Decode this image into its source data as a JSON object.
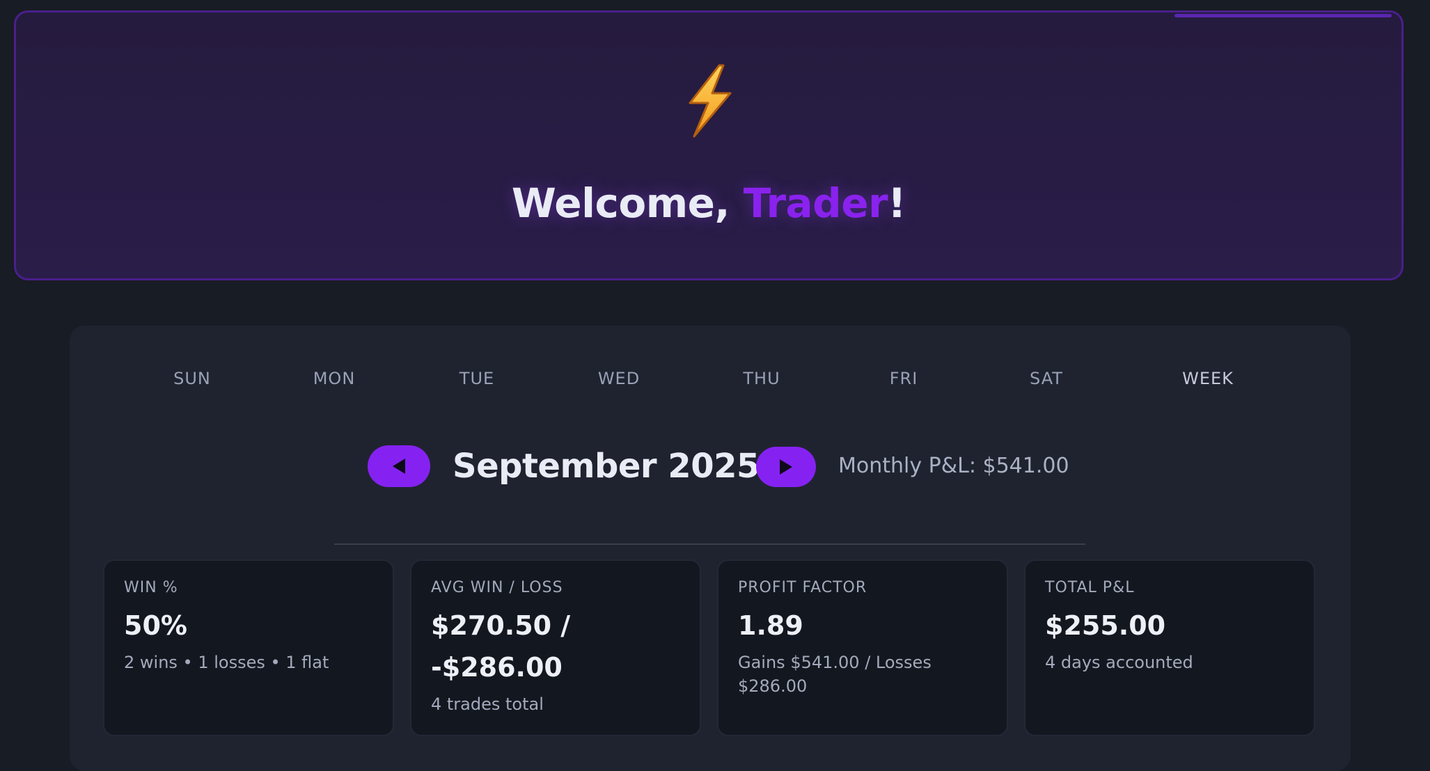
{
  "hero": {
    "icon": "lightning-bolt-icon",
    "greeting": "Welcome, ",
    "name": "Trader",
    "suffix": "!"
  },
  "calendar": {
    "weekdays": [
      "SUN",
      "MON",
      "TUE",
      "WED",
      "THU",
      "FRI",
      "SAT",
      "WEEK"
    ],
    "month_title": "September 2025",
    "monthly_pnl": "Monthly P&L: $541.00",
    "prev_icon": "triangle-left-icon",
    "next_icon": "triangle-right-icon"
  },
  "stats": [
    {
      "label": "WIN %",
      "value": "50%",
      "sub": "2 wins • 1 losses • 1 flat"
    },
    {
      "label": "AVG WIN / LOSS",
      "value": "$270.50 / -$286.00",
      "sub": "4 trades total"
    },
    {
      "label": "PROFIT FACTOR",
      "value": "1.89",
      "sub": "Gains $541.00 / Losses $286.00"
    },
    {
      "label": "TOTAL P&L",
      "value": "$255.00",
      "sub": "4 days accounted"
    }
  ],
  "colors": {
    "accent": "#8522f1",
    "background": "#181c24",
    "panel": "#1f2330",
    "card": "#131720"
  }
}
